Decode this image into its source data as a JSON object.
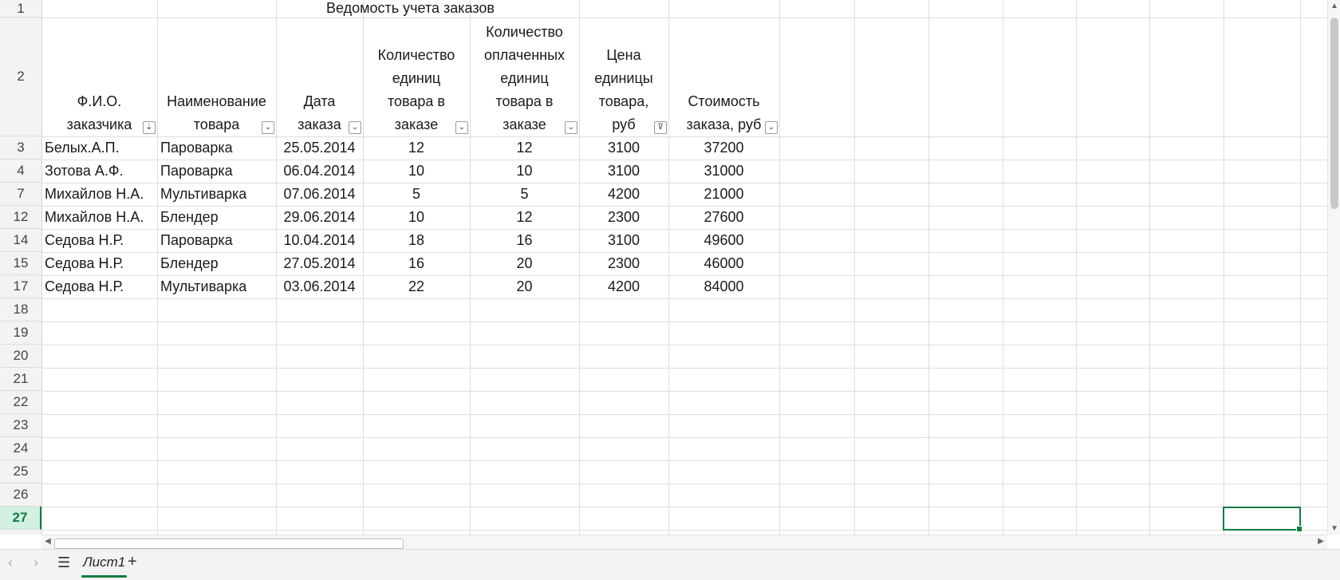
{
  "sheet": {
    "title": "Ведомость учета заказов",
    "columns": [
      {
        "key": "fio",
        "header": [
          "Ф.И.О.",
          "заказчика"
        ],
        "filter": "sort-asc"
      },
      {
        "key": "product",
        "header": [
          "Наименование",
          "товара"
        ],
        "filter": "dropdown"
      },
      {
        "key": "date",
        "header": [
          "Дата",
          "заказа"
        ],
        "filter": "dropdown"
      },
      {
        "key": "qty",
        "header": [
          "Количество",
          "единиц",
          "товара в",
          "заказе"
        ],
        "filter": "dropdown"
      },
      {
        "key": "paid",
        "header": [
          "Количество",
          "оплаченных",
          "единиц",
          "товара в",
          "заказе"
        ],
        "filter": "dropdown"
      },
      {
        "key": "price",
        "header": [
          "Цена",
          "единицы",
          "товара,",
          "руб"
        ],
        "filter": "filtered"
      },
      {
        "key": "cost",
        "header": [
          "Стоимость",
          "заказа, руб"
        ],
        "filter": "dropdown"
      }
    ],
    "rows": [
      {
        "num": "3",
        "fio": "Белых.А.П.",
        "product": "Пароварка",
        "date": "25.05.2014",
        "qty": "12",
        "paid": "12",
        "price": "3100",
        "cost": "37200"
      },
      {
        "num": "4",
        "fio": "Зотова А.Ф.",
        "product": "Пароварка",
        "date": "06.04.2014",
        "qty": "10",
        "paid": "10",
        "price": "3100",
        "cost": "31000"
      },
      {
        "num": "7",
        "fio": "Михайлов Н.А.",
        "product": "Мультиварка",
        "date": "07.06.2014",
        "qty": "5",
        "paid": "5",
        "price": "4200",
        "cost": "21000"
      },
      {
        "num": "12",
        "fio": "Михайлов Н.А.",
        "product": "Блендер",
        "date": "29.06.2014",
        "qty": "10",
        "paid": "12",
        "price": "2300",
        "cost": "27600"
      },
      {
        "num": "14",
        "fio": "Седова Н.Р.",
        "product": "Пароварка",
        "date": "10.04.2014",
        "qty": "18",
        "paid": "16",
        "price": "3100",
        "cost": "49600"
      },
      {
        "num": "15",
        "fio": "Седова Н.Р.",
        "product": "Блендер",
        "date": "27.05.2014",
        "qty": "16",
        "paid": "20",
        "price": "2300",
        "cost": "46000"
      },
      {
        "num": "17",
        "fio": "Седова Н.Р.",
        "product": "Мультиварка",
        "date": "03.06.2014",
        "qty": "22",
        "paid": "20",
        "price": "4200",
        "cost": "84000"
      }
    ],
    "empty_rows": [
      "18",
      "19",
      "20",
      "21",
      "22",
      "23",
      "24",
      "25",
      "26",
      "27"
    ],
    "header_row_labels": [
      "1",
      "2"
    ],
    "active_row": "27"
  },
  "tabs": {
    "prev_label": "‹",
    "next_label": "›",
    "menu_label": "☰",
    "add_label": "+",
    "sheets": [
      "Лист1"
    ]
  },
  "colors": {
    "accent": "#107c41",
    "grid": "#dedede"
  }
}
